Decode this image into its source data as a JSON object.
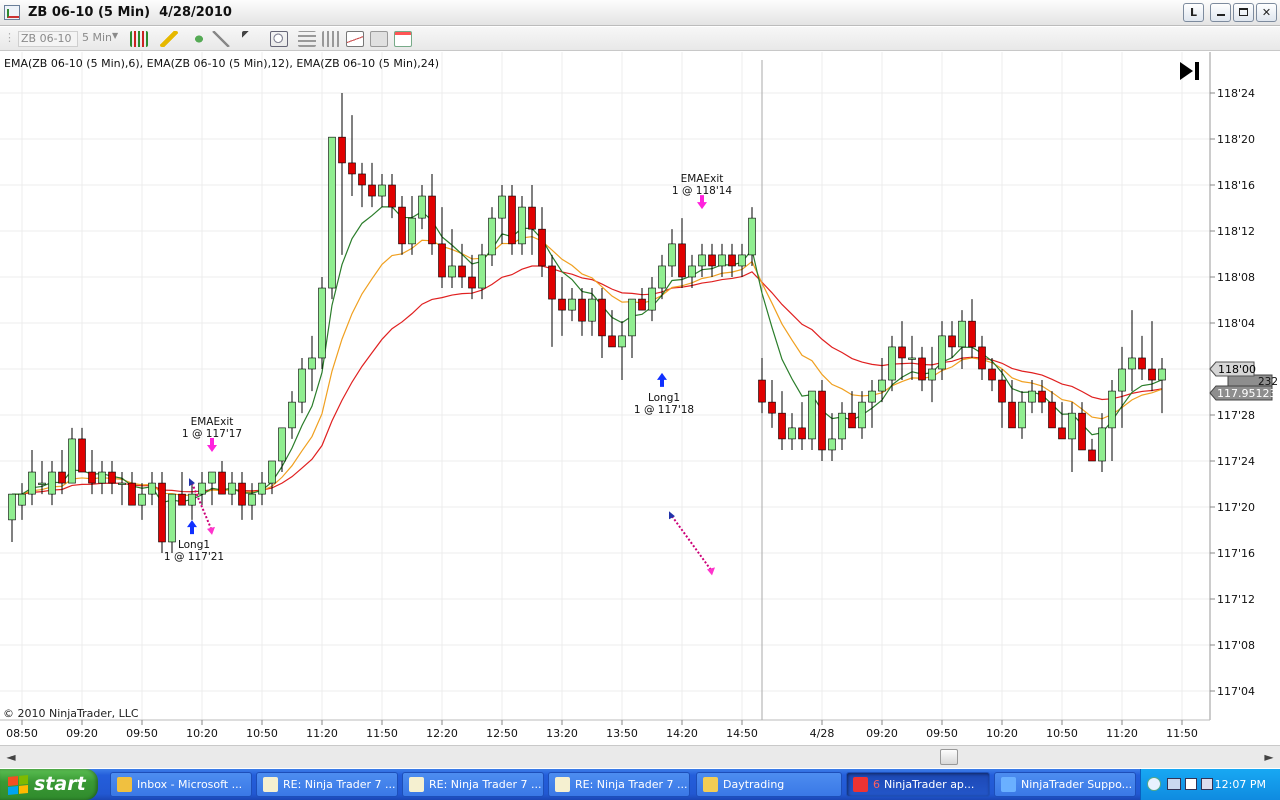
{
  "window": {
    "title": "ZB 06-10 (5 Min)  4/28/2010",
    "btn_min": "L",
    "btn_restore": "",
    "btn_max": "",
    "btn_close": "✕"
  },
  "toolbar": {
    "instrument": "ZB 06-10",
    "interval": "5 Min"
  },
  "chart": {
    "indicator_label": "EMA(ZB 06-10 (5 Min),6), EMA(ZB 06-10 (5 Min),12), EMA(ZB 06-10 (5 Min),24)",
    "copyright": "© 2010 NinjaTrader, LLC",
    "price_ticks": [
      {
        "label": "118'24",
        "value": 118.75
      },
      {
        "label": "118'20",
        "value": 118.625
      },
      {
        "label": "118'16",
        "value": 118.5
      },
      {
        "label": "118'12",
        "value": 118.375
      },
      {
        "label": "118'08",
        "value": 118.25
      },
      {
        "label": "118'04",
        "value": 118.125
      },
      {
        "label": "118'00",
        "value": 118.0
      },
      {
        "label": "117'28",
        "value": 117.875
      },
      {
        "label": "117'24",
        "value": 117.75
      },
      {
        "label": "117'20",
        "value": 117.625
      },
      {
        "label": "117'16",
        "value": 117.5
      },
      {
        "label": "117'12",
        "value": 117.375
      },
      {
        "label": "117'08",
        "value": 117.25
      },
      {
        "label": "117'04",
        "value": 117.125
      }
    ],
    "time_ticks": [
      {
        "label": "08:50",
        "bar": 0
      },
      {
        "label": "09:20",
        "bar": 6
      },
      {
        "label": "09:50",
        "bar": 12
      },
      {
        "label": "10:20",
        "bar": 18
      },
      {
        "label": "10:50",
        "bar": 24
      },
      {
        "label": "11:20",
        "bar": 30
      },
      {
        "label": "11:50",
        "bar": 36
      },
      {
        "label": "12:20",
        "bar": 42
      },
      {
        "label": "12:50",
        "bar": 48
      },
      {
        "label": "13:20",
        "bar": 54
      },
      {
        "label": "13:50",
        "bar": 60
      },
      {
        "label": "14:20",
        "bar": 66
      },
      {
        "label": "14:50",
        "bar": 72
      },
      {
        "label": "4/28",
        "bar": 80
      },
      {
        "label": "09:20",
        "bar": 86
      },
      {
        "label": "09:50",
        "bar": 92
      },
      {
        "label": "10:20",
        "bar": 98
      },
      {
        "label": "10:50",
        "bar": 104
      },
      {
        "label": "11:20",
        "bar": 110
      },
      {
        "label": "11:50",
        "bar": 116
      }
    ],
    "last_price_label": "118'00",
    "last_price": 118.0,
    "ema_value_label": "117.95123",
    "ema_value": 117.95123,
    "ema_badge_partial": "232",
    "session_break_bar": 75,
    "candles": [
      [
        117.59,
        117.66,
        117.53,
        117.66
      ],
      [
        117.63,
        117.69,
        117.59,
        117.66
      ],
      [
        117.66,
        117.78,
        117.63,
        117.72
      ],
      [
        117.69,
        117.75,
        117.66,
        117.69
      ],
      [
        117.66,
        117.75,
        117.63,
        117.72
      ],
      [
        117.72,
        117.78,
        117.66,
        117.69
      ],
      [
        117.69,
        117.84,
        117.69,
        117.81
      ],
      [
        117.81,
        117.84,
        117.72,
        117.72
      ],
      [
        117.72,
        117.78,
        117.66,
        117.69
      ],
      [
        117.69,
        117.75,
        117.66,
        117.72
      ],
      [
        117.72,
        117.75,
        117.66,
        117.69
      ],
      [
        117.69,
        117.72,
        117.63,
        117.69
      ],
      [
        117.69,
        117.72,
        117.63,
        117.63
      ],
      [
        117.63,
        117.69,
        117.59,
        117.66
      ],
      [
        117.66,
        117.72,
        117.63,
        117.69
      ],
      [
        117.69,
        117.72,
        117.5,
        117.53
      ],
      [
        117.53,
        117.66,
        117.5,
        117.66
      ],
      [
        117.66,
        117.72,
        117.63,
        117.63
      ],
      [
        117.63,
        117.69,
        117.59,
        117.66
      ],
      [
        117.66,
        117.72,
        117.63,
        117.69
      ],
      [
        117.69,
        117.72,
        117.63,
        117.72
      ],
      [
        117.72,
        117.75,
        117.66,
        117.66
      ],
      [
        117.66,
        117.72,
        117.63,
        117.69
      ],
      [
        117.69,
        117.72,
        117.59,
        117.63
      ],
      [
        117.63,
        117.69,
        117.59,
        117.66
      ],
      [
        117.66,
        117.72,
        117.63,
        117.69
      ],
      [
        117.69,
        117.75,
        117.66,
        117.75
      ],
      [
        117.75,
        117.84,
        117.72,
        117.84
      ],
      [
        117.84,
        117.94,
        117.81,
        117.91
      ],
      [
        117.91,
        118.03,
        117.88,
        118.0
      ],
      [
        118.0,
        118.09,
        117.94,
        118.03
      ],
      [
        118.03,
        118.25,
        118.0,
        118.22
      ],
      [
        118.22,
        118.56,
        118.19,
        118.63
      ],
      [
        118.63,
        118.75,
        118.31,
        118.56
      ],
      [
        118.56,
        118.69,
        118.47,
        118.53
      ],
      [
        118.53,
        118.56,
        118.44,
        118.5
      ],
      [
        118.5,
        118.56,
        118.44,
        118.47
      ],
      [
        118.47,
        118.53,
        118.44,
        118.5
      ],
      [
        118.5,
        118.53,
        118.41,
        118.44
      ],
      [
        118.44,
        118.47,
        118.31,
        118.34
      ],
      [
        118.34,
        118.47,
        118.31,
        118.41
      ],
      [
        118.41,
        118.5,
        118.38,
        118.47
      ],
      [
        118.47,
        118.53,
        118.31,
        118.34
      ],
      [
        118.34,
        118.44,
        118.22,
        118.25
      ],
      [
        118.25,
        118.38,
        118.22,
        118.28
      ],
      [
        118.28,
        118.34,
        118.22,
        118.25
      ],
      [
        118.25,
        118.31,
        118.19,
        118.22
      ],
      [
        118.22,
        118.34,
        118.19,
        118.31
      ],
      [
        118.31,
        118.44,
        118.28,
        118.41
      ],
      [
        118.41,
        118.5,
        118.34,
        118.47
      ],
      [
        118.47,
        118.5,
        118.31,
        118.34
      ],
      [
        118.34,
        118.47,
        118.31,
        118.44
      ],
      [
        118.44,
        118.5,
        118.31,
        118.38
      ],
      [
        118.38,
        118.44,
        118.25,
        118.28
      ],
      [
        118.28,
        118.31,
        118.06,
        118.19
      ],
      [
        118.19,
        118.25,
        118.09,
        118.16
      ],
      [
        118.16,
        118.22,
        118.13,
        118.19
      ],
      [
        118.19,
        118.22,
        118.09,
        118.13
      ],
      [
        118.13,
        118.22,
        118.09,
        118.19
      ],
      [
        118.19,
        118.22,
        118.03,
        118.09
      ],
      [
        118.09,
        118.16,
        118.06,
        118.06
      ],
      [
        118.06,
        118.13,
        117.97,
        118.09
      ],
      [
        118.09,
        118.16,
        118.03,
        118.19
      ],
      [
        118.19,
        118.22,
        118.16,
        118.16
      ],
      [
        118.16,
        118.25,
        118.13,
        118.22
      ],
      [
        118.22,
        118.31,
        118.19,
        118.28
      ],
      [
        118.28,
        118.38,
        118.25,
        118.34
      ],
      [
        118.34,
        118.41,
        118.22,
        118.25
      ],
      [
        118.25,
        118.31,
        118.22,
        118.28
      ],
      [
        118.28,
        118.34,
        118.25,
        118.31
      ],
      [
        118.31,
        118.34,
        118.25,
        118.28
      ],
      [
        118.28,
        118.34,
        118.25,
        118.31
      ],
      [
        118.31,
        118.34,
        118.25,
        118.28
      ],
      [
        118.28,
        118.34,
        118.25,
        118.31
      ],
      [
        118.31,
        118.44,
        118.28,
        118.41
      ],
      [
        117.97,
        118.03,
        117.88,
        117.91
      ],
      [
        117.91,
        117.97,
        117.84,
        117.88
      ],
      [
        117.88,
        117.94,
        117.78,
        117.81
      ],
      [
        117.81,
        117.88,
        117.78,
        117.84
      ],
      [
        117.84,
        117.91,
        117.78,
        117.81
      ],
      [
        117.81,
        117.94,
        117.78,
        117.94
      ],
      [
        117.94,
        117.97,
        117.75,
        117.78
      ],
      [
        117.78,
        117.88,
        117.75,
        117.81
      ],
      [
        117.81,
        117.91,
        117.78,
        117.88
      ],
      [
        117.88,
        117.94,
        117.84,
        117.84
      ],
      [
        117.84,
        117.94,
        117.81,
        117.91
      ],
      [
        117.91,
        117.97,
        117.84,
        117.94
      ],
      [
        117.94,
        118.03,
        117.91,
        117.97
      ],
      [
        117.97,
        118.09,
        117.94,
        118.06
      ],
      [
        118.06,
        118.13,
        117.97,
        118.03
      ],
      [
        118.03,
        118.09,
        117.97,
        118.03
      ],
      [
        118.03,
        118.06,
        117.94,
        117.97
      ],
      [
        117.97,
        118.06,
        117.91,
        118.0
      ],
      [
        118.0,
        118.13,
        117.97,
        118.09
      ],
      [
        118.09,
        118.13,
        118.03,
        118.06
      ],
      [
        118.06,
        118.16,
        118.0,
        118.13
      ],
      [
        118.13,
        118.19,
        118.03,
        118.06
      ],
      [
        118.06,
        118.09,
        117.97,
        118.0
      ],
      [
        118.0,
        118.03,
        117.94,
        117.97
      ],
      [
        117.97,
        118.0,
        117.84,
        117.91
      ],
      [
        117.91,
        117.97,
        117.84,
        117.84
      ],
      [
        117.84,
        117.94,
        117.81,
        117.91
      ],
      [
        117.91,
        117.97,
        117.88,
        117.94
      ],
      [
        117.94,
        117.97,
        117.88,
        117.91
      ],
      [
        117.91,
        117.94,
        117.84,
        117.84
      ],
      [
        117.84,
        117.91,
        117.81,
        117.81
      ],
      [
        117.81,
        117.91,
        117.72,
        117.88
      ],
      [
        117.88,
        117.91,
        117.78,
        117.78
      ],
      [
        117.78,
        117.81,
        117.75,
        117.75
      ],
      [
        117.75,
        117.88,
        117.72,
        117.84
      ],
      [
        117.84,
        117.97,
        117.75,
        117.94
      ],
      [
        117.94,
        118.06,
        117.84,
        118.0
      ],
      [
        118.0,
        118.16,
        117.94,
        118.03
      ],
      [
        118.03,
        118.09,
        117.97,
        118.0
      ],
      [
        118.0,
        118.13,
        117.94,
        117.97
      ],
      [
        117.97,
        118.03,
        117.88,
        118.0
      ]
    ],
    "trades": [
      {
        "type": "entry",
        "name": "Long1",
        "detail": "1 @ 117'21",
        "bar": 18,
        "price": 117.66
      },
      {
        "type": "exit",
        "name": "EMAExit",
        "detail": "1 @ 117'17",
        "bar": 20,
        "price": 117.72
      },
      {
        "type": "entry",
        "name": "Long1",
        "detail": "1 @ 117'18",
        "bar": 65,
        "price": 118.06
      },
      {
        "type": "exit",
        "name": "EMAExit",
        "detail": "1 @ 118'14",
        "bar": 69,
        "price": 118.38
      }
    ],
    "trade_lines": [
      {
        "from_bar": 18,
        "from_price": 117.69,
        "to_bar": 20,
        "to_price": 117.56
      },
      {
        "from_bar": 66,
        "from_price": 117.6,
        "to_bar": 70,
        "to_price": 117.45
      }
    ],
    "ema_colors": {
      "ema6": "#2a7d2a",
      "ema12": "#f0a020",
      "ema24": "#e02020"
    },
    "up_color": "#90ee90",
    "down_color": "#e00000"
  },
  "scrollbar": {
    "left": "◄",
    "right": "►"
  },
  "taskbar": {
    "start": "start",
    "tasks": [
      {
        "label": "Inbox - Microsoft ...",
        "icon": "outlook-icon"
      },
      {
        "label": "RE: Ninja Trader 7 ...",
        "icon": "mail-icon"
      },
      {
        "label": "RE: Ninja Trader 7 ...",
        "icon": "mail-icon"
      },
      {
        "label": "RE: Ninja Trader 7 ...",
        "icon": "mail-icon"
      },
      {
        "label": "Daytrading",
        "icon": "folder-icon"
      },
      {
        "label": "NinjaTrader ap...",
        "icon": "ninjatrader-icon",
        "active": true,
        "badge": "6"
      },
      {
        "label": "NinjaTrader Suppo...",
        "icon": "ie-icon"
      }
    ],
    "clock": "12:07 PM"
  }
}
